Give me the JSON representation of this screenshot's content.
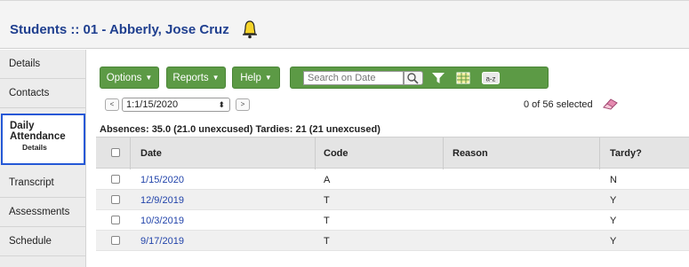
{
  "header": {
    "title": "Students :: 01 - Abberly, Jose Cruz",
    "alert_icon": "bell-icon"
  },
  "sidebar": {
    "items": [
      {
        "label": "Details"
      },
      {
        "label": "Contacts"
      },
      {
        "label": "Daily Attendance",
        "sub": "Details"
      },
      {
        "label": "Transcript"
      },
      {
        "label": "Assessments"
      },
      {
        "label": "Schedule"
      }
    ]
  },
  "toolbar": {
    "options_label": "Options",
    "reports_label": "Reports",
    "help_label": "Help",
    "search_placeholder": "Search on Date",
    "icons": [
      "search-icon",
      "filter-icon",
      "grid-icon",
      "sort-az-icon"
    ],
    "sort_label": "a-z"
  },
  "navigation": {
    "prev_label": "<",
    "next_label": ">",
    "record_value": "1:1/15/2020",
    "selected_count": "0 of 56 selected"
  },
  "summary": "Absences: 35.0 (21.0 unexcused) Tardies: 21 (21 unexcused)",
  "table": {
    "columns": [
      "Date",
      "Code",
      "Reason",
      "Tardy?"
    ],
    "rows": [
      {
        "date": "1/15/2020",
        "code": "A",
        "reason": "",
        "tardy": "N"
      },
      {
        "date": "12/9/2019",
        "code": "T",
        "reason": "",
        "tardy": "Y"
      },
      {
        "date": "10/3/2019",
        "code": "T",
        "reason": "",
        "tardy": "Y"
      },
      {
        "date": "9/17/2019",
        "code": "T",
        "reason": "",
        "tardy": "Y"
      }
    ]
  },
  "colors": {
    "title": "#1f3f8f",
    "toolbar_green": "#5c9a45",
    "active_border": "#2458d6",
    "link": "#2244aa"
  }
}
